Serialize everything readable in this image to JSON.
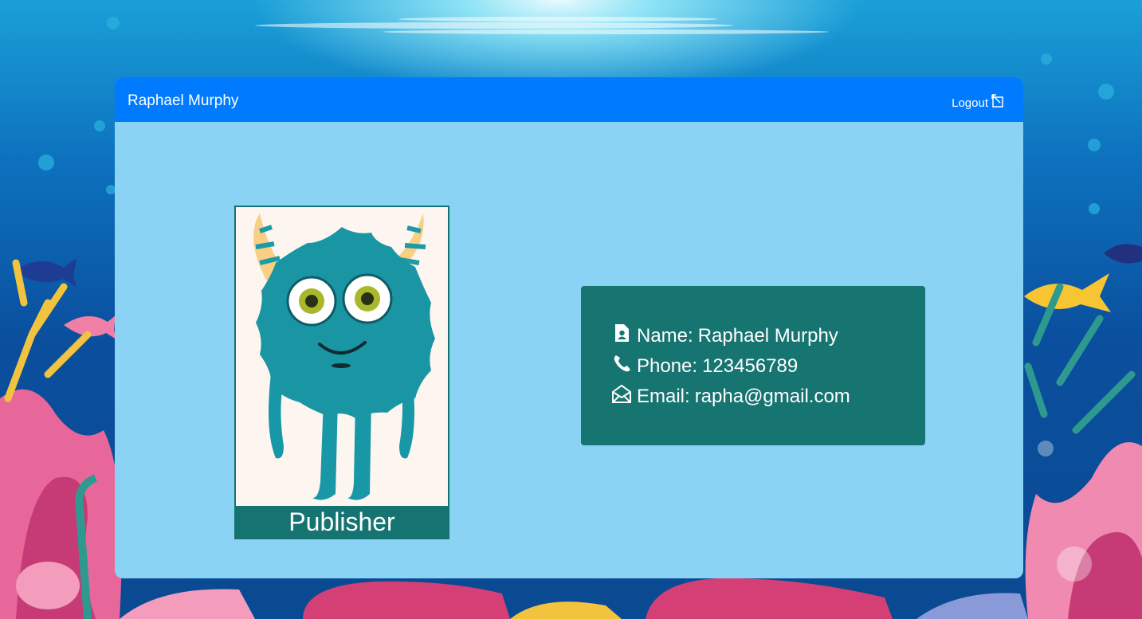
{
  "header": {
    "user_name": "Raphael Murphy",
    "logout_label": "Logout"
  },
  "avatar": {
    "role": "Publisher"
  },
  "profile": {
    "name_label": "Name:",
    "name_value": "Raphael Murphy",
    "phone_label": "Phone:",
    "phone_value": "123456789",
    "email_label": "Email:",
    "email_value": "rapha@gmail.com"
  },
  "colors": {
    "header": "#007bff",
    "card": "#8ad3f5",
    "accent": "#157471"
  },
  "icons": [
    "logout-icon",
    "contact-card-icon",
    "phone-icon",
    "envelope-open-icon"
  ]
}
